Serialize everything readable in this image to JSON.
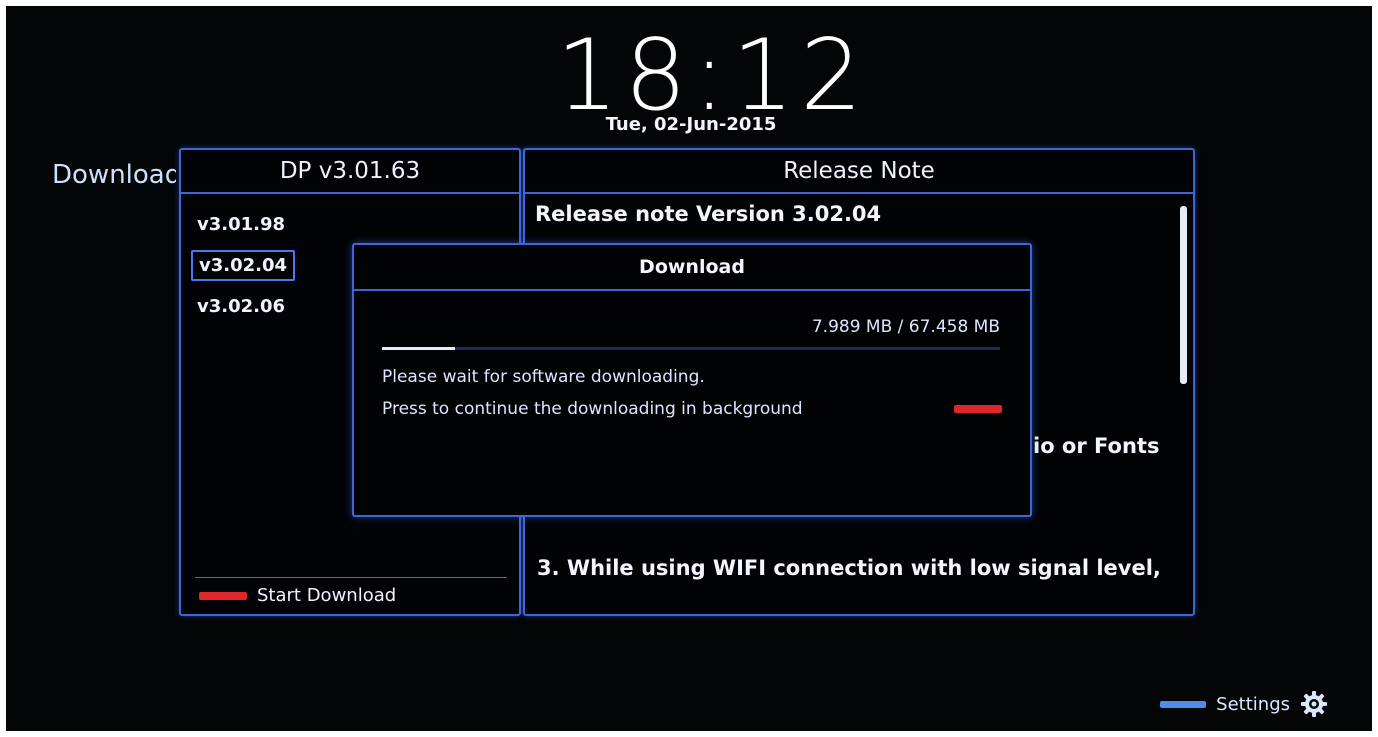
{
  "clock": {
    "time": "18:12",
    "date": "Tue, 02-Jun-2015"
  },
  "page": {
    "title": "Download"
  },
  "left_panel": {
    "header": "DP v3.01.63",
    "versions": [
      {
        "label": "v3.01.98"
      },
      {
        "label": "v3.02.04",
        "selected": true
      },
      {
        "label": "v3.02.06"
      }
    ],
    "start_download_label": "Start Download",
    "start_download_color": "#e0262b"
  },
  "right_panel": {
    "header": "Release Note",
    "lines": [
      "Release note Version 3.02.04",
      "io or Fonts",
      "3. While using WIFI connection with low signal level,"
    ]
  },
  "dialog": {
    "title": "Download",
    "downloaded": "7.989 MB / 67.458 MB",
    "progress_fraction": 0.118,
    "message_wait": "Please wait for software downloading.",
    "message_background": "Press to continue the downloading in background",
    "background_key_color": "#e0262b"
  },
  "footer": {
    "settings_label": "Settings",
    "settings_key_color": "#4d8fe8",
    "settings_icon": "gear-icon"
  }
}
